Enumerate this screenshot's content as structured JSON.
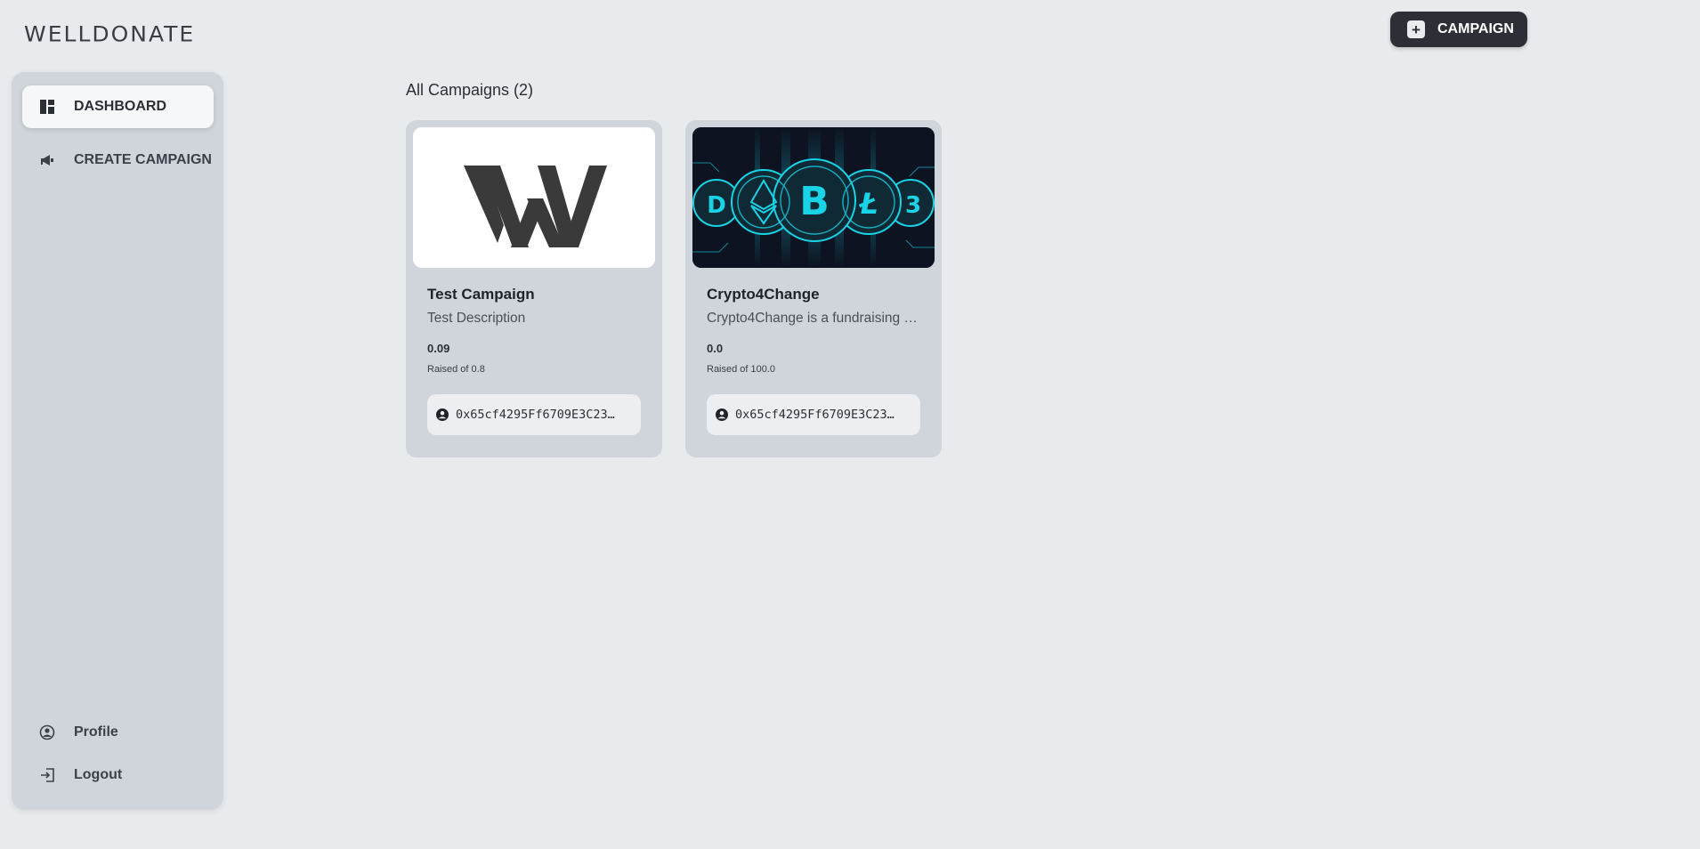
{
  "app": {
    "logo_text": "WELLDONATE"
  },
  "header": {
    "new_campaign_label": "CAMPAIGN"
  },
  "sidebar": {
    "items": [
      {
        "label": "DASHBOARD",
        "icon": "dashboard-icon",
        "active": true
      },
      {
        "label": "CREATE CAMPAIGN",
        "icon": "megaphone-icon",
        "active": false
      }
    ],
    "bottom_items": [
      {
        "label": "Profile",
        "icon": "user-circle-icon"
      },
      {
        "label": "Logout",
        "icon": "logout-icon"
      }
    ]
  },
  "main": {
    "section_title": "All Campaigns (2)",
    "campaigns": [
      {
        "title": "Test Campaign",
        "description": "Test Description",
        "amount": "0.09",
        "raised_text": "Raised of 0.8",
        "owner_address": "0x65cf4295Ff6709E3C23…",
        "image": "welldonate-logo-image"
      },
      {
        "title": "Crypto4Change",
        "description": "Crypto4Change is a fundraising …",
        "amount": "0.0",
        "raised_text": "Raised of 100.0",
        "owner_address": "0x65cf4295Ff6709E3C23…",
        "image": "crypto-coins-image"
      }
    ]
  },
  "colors": {
    "background": "#e8ebee",
    "sidebar": "#d0d5db",
    "button_dark": "#2c3036",
    "accent_cyan": "#19d3e6"
  }
}
